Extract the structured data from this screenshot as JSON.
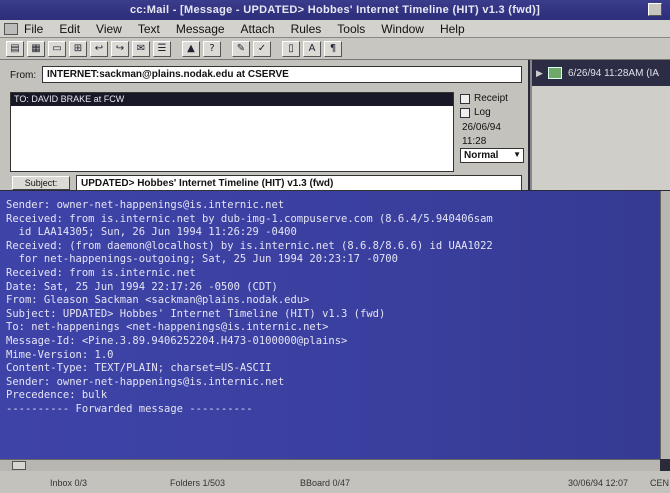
{
  "window": {
    "title": "cc:Mail - [Message - UPDATED> Hobbes' Internet Timeline (HIT) v1.3 (fwd)]"
  },
  "menu": [
    "File",
    "Edit",
    "View",
    "Text",
    "Message",
    "Attach",
    "Rules",
    "Tools",
    "Window",
    "Help"
  ],
  "header": {
    "from_label": "From:",
    "from_value": "INTERNET:sackman@plains.nodak.edu at CSERVE",
    "to_value": "TO: DAVID BRAKE at FCW",
    "receipt_label": "Receipt",
    "log_label": "Log",
    "date": "26/06/94",
    "time": "11:28",
    "priority": "Normal",
    "subject_button": "Subject:",
    "subject_value": "UPDATED> Hobbes' Internet Timeline (HIT) v1.3 (fwd)"
  },
  "side": {
    "item": "6/26/94 11:28AM (IA"
  },
  "body_lines": [
    "Sender: owner-net-happenings@is.internic.net",
    "Received: from is.internic.net by dub-img-1.compuserve.com (8.6.4/5.940406sam",
    "  id LAA14305; Sun, 26 Jun 1994 11:26:29 -0400",
    "Received: (from daemon@localhost) by is.internic.net (8.6.8/8.6.6) id UAA1022",
    "  for net-happenings-outgoing; Sat, 25 Jun 1994 20:23:17 -0700",
    "Received: from is.internic.net",
    "Date: Sat, 25 Jun 1994 22:17:26 -0500 (CDT)",
    "From: Gleason Sackman <sackman@plains.nodak.edu>",
    "Subject: UPDATED> Hobbes' Internet Timeline (HIT) v1.3 (fwd)",
    "To: net-happenings <net-happenings@is.internic.net>",
    "Message-Id: <Pine.3.89.9406252204.H473-0100000@plains>",
    "Mime-Version: 1.0",
    "Content-Type: TEXT/PLAIN; charset=US-ASCII",
    "Sender: owner-net-happenings@is.internic.net",
    "Precedence: bulk",
    "",
    "---------- Forwarded message ----------"
  ],
  "status": {
    "inbox": "Inbox 0/3",
    "folders": "Folders 1/503",
    "bboard": "BBoard 0/47",
    "datetime": "30/06/94  12:07",
    "cap": "CEN"
  }
}
